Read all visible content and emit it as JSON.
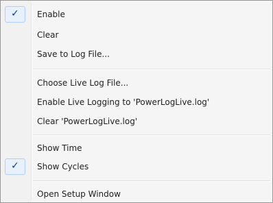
{
  "menu": {
    "check_glyph": "✓",
    "items": [
      {
        "label": "Enable",
        "checked": true
      },
      {
        "label": "Clear",
        "checked": false
      },
      {
        "label": "Save to Log File...",
        "checked": false
      },
      {
        "label": "Choose Live Log File...",
        "checked": false
      },
      {
        "label": "Enable Live Logging to 'PowerLogLive.log'",
        "checked": false
      },
      {
        "label": "Clear 'PowerLogLive.log'",
        "checked": false
      },
      {
        "label": "Show Time",
        "checked": false
      },
      {
        "label": "Show Cycles",
        "checked": true
      },
      {
        "label": "Open Setup Window",
        "checked": false
      }
    ]
  },
  "colors": {
    "check": "#0b3f8c",
    "check_highlight": "#e8f0fb",
    "border": "#979797",
    "background": "#f5f5f5"
  }
}
